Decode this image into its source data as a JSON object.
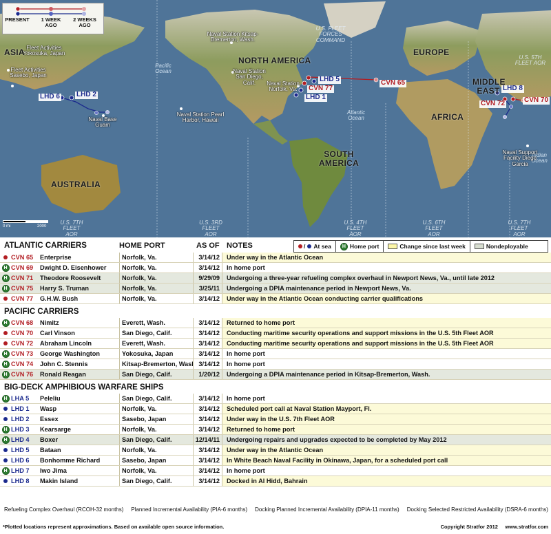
{
  "map": {
    "legend": {
      "labels": [
        "PRESENT",
        "1 WEEK AGO",
        "2 WEEKS AGO"
      ]
    },
    "continents": [
      "NORTH AMERICA",
      "SOUTH AMERICA",
      "EUROPE",
      "ASIA",
      "AFRICA",
      "AUSTRALIA",
      "MIDDLE EAST"
    ],
    "oceans": [
      "Pacific Ocean",
      "Atlantic Ocean",
      "Indian Ocean"
    ],
    "fleet_labels": [
      "U.S. FLEET FORCES COMMAND",
      "U.S. 5TH FLEET AOR",
      "U.S. 7TH FLEET AOR",
      "U.S. 3RD FLEET AOR",
      "U.S. 4TH FLEET AOR",
      "U.S. 6TH FLEET AOR",
      "U.S. 7TH FLEET AOR"
    ],
    "bases": [
      "Fleet Activities Yokosuka, Japan",
      "Fleet Activities Sasebo, Japan",
      "Naval Base Guam",
      "Naval Station Pearl Harbor, Hawaii",
      "Naval Station Kitsap-Bremerton, Wash.",
      "Naval Station San Diego, Calif.",
      "Naval Station Norfolk, Va.",
      "Naval Support Facility Diego Garcia"
    ],
    "ship_labels": {
      "lhd6": "LHD 6",
      "lhd2": "LHD 2",
      "lhd5": "LHD 5",
      "cvn77": "CVN 77",
      "lhd1": "LHD 1",
      "cvn65": "CVN 65",
      "lhd8": "LHD 8",
      "cvn72": "CVN 72",
      "cvn70": "CVN 70"
    },
    "scale": {
      "left": "0 mi",
      "right": "2000"
    },
    "colors": {
      "red": "#b21d22",
      "blue": "#1b2a8d",
      "home": "#2f7d32",
      "ocean": "#4d7296",
      "land": "#8a9a5b"
    }
  },
  "key": {
    "at_sea": "At sea",
    "home_port": "Home port",
    "change": "Change since last week",
    "nondeployable": "Nondeployable"
  },
  "columns": {
    "home_port": "HOME PORT",
    "as_of": "AS OF",
    "notes": "NOTES"
  },
  "sections": [
    {
      "title": "ATLANTIC CARRIERS",
      "rows": [
        {
          "status": "sea",
          "color": "red",
          "hull": "CVN 65",
          "name": "Enterprise",
          "port": "Norfolk, Va.",
          "asof": "3/14/12",
          "notes": "Under way in the Atlantic Ocean"
        },
        {
          "status": "home",
          "color": "red",
          "hull": "CVN 69",
          "name": "Dwight D. Eisenhower",
          "port": "Norfolk, Va.",
          "asof": "3/14/12",
          "notes": "In home port"
        },
        {
          "status": "nd",
          "color": "red",
          "hull": "CVN 71",
          "name": "Theodore Roosevelt",
          "port": "Norfolk, Va.",
          "asof": "9/29/09",
          "notes": "Undergoing a three-year refueling complex overhaul in Newport News, Va., until late 2012"
        },
        {
          "status": "nd",
          "color": "red",
          "hull": "CVN 75",
          "name": "Harry S. Truman",
          "port": "Norfolk, Va.",
          "asof": "3/25/11",
          "notes": "Undergoing a DPIA maintenance period in Newport News, Va."
        },
        {
          "status": "sea",
          "color": "red",
          "hull": "CVN 77",
          "name": "G.H.W. Bush",
          "port": "Norfolk, Va.",
          "asof": "3/14/12",
          "notes": "Under way in the Atlantic Ocean conducting carrier qualifications"
        }
      ]
    },
    {
      "title": "PACIFIC CARRIERS",
      "rows": [
        {
          "status": "change",
          "color": "red",
          "hull": "CVN 68",
          "name": "Nimitz",
          "port": "Everett, Wash.",
          "asof": "3/14/12",
          "notes": "Returned to home port"
        },
        {
          "status": "sea",
          "color": "red",
          "hull": "CVN 70",
          "name": "Carl Vinson",
          "port": "San Diego, Calif.",
          "asof": "3/14/12",
          "notes": "Conducting maritime security operations and support missions in the U.S. 5th Fleet AOR"
        },
        {
          "status": "sea",
          "color": "red",
          "hull": "CVN 72",
          "name": "Abraham Lincoln",
          "port": "Everett, Wash.",
          "asof": "3/14/12",
          "notes": "Conducting maritime security operations and support missions in the U.S. 5th Fleet AOR"
        },
        {
          "status": "home",
          "color": "red",
          "hull": "CVN 73",
          "name": "George Washington",
          "port": "Yokosuka, Japan",
          "asof": "3/14/12",
          "notes": "In home port"
        },
        {
          "status": "home",
          "color": "red",
          "hull": "CVN 74",
          "name": "John C. Stennis",
          "port": "Kitsap-Bremerton, Wash.",
          "asof": "3/14/12",
          "notes": "In home port"
        },
        {
          "status": "nd",
          "color": "red",
          "hull": "CVN 76",
          "name": "Ronald Reagan",
          "port": "San Diego, Calif.",
          "asof": "1/20/12",
          "notes": "Undergoing a DPIA maintenance period in Kitsap-Bremerton, Wash."
        }
      ]
    },
    {
      "title": "BIG-DECK AMPHIBIOUS WARFARE SHIPS",
      "rows": [
        {
          "status": "home",
          "color": "blue",
          "hull": "LHA 5",
          "name": "Peleliu",
          "port": "San Diego, Calif.",
          "asof": "3/14/12",
          "notes": "In home port"
        },
        {
          "status": "sea",
          "color": "blue",
          "hull": "LHD 1",
          "name": "Wasp",
          "port": "Norfolk, Va.",
          "asof": "3/14/12",
          "notes": "Scheduled port call at Naval Station Mayport, Fl."
        },
        {
          "status": "sea",
          "color": "blue",
          "hull": "LHD 2",
          "name": "Essex",
          "port": "Sasebo, Japan",
          "asof": "3/14/12",
          "notes": "Under way in the U.S. 7th Fleet AOR"
        },
        {
          "status": "change",
          "color": "blue",
          "hull": "LHD 3",
          "name": "Kearsarge",
          "port": "Norfolk, Va.",
          "asof": "3/14/12",
          "notes": "Returned to home port"
        },
        {
          "status": "nd",
          "color": "blue",
          "hull": "LHD 4",
          "name": "Boxer",
          "port": "San Diego, Calif.",
          "asof": "12/14/11",
          "notes": "Undergoing repairs and upgrades expected to be completed by May 2012"
        },
        {
          "status": "sea",
          "color": "blue",
          "hull": "LHD 5",
          "name": "Bataan",
          "port": "Norfolk, Va.",
          "asof": "3/14/12",
          "notes": "Under way in the Atlantic Ocean"
        },
        {
          "status": "sea",
          "color": "blue",
          "hull": "LHD 6",
          "name": "Bonhomme Richard",
          "port": "Sasebo, Japan",
          "asof": "3/14/12",
          "notes": "In White Beach Naval Facility in Okinawa, Japan, for a scheduled port call"
        },
        {
          "status": "home",
          "color": "blue",
          "hull": "LHD 7",
          "name": "Iwo Jima",
          "port": "Norfolk, Va.",
          "asof": "3/14/12",
          "notes": "In home port"
        },
        {
          "status": "sea",
          "color": "blue",
          "hull": "LHD 8",
          "name": "Makin Island",
          "port": "San Diego, Calif.",
          "asof": "3/14/12",
          "notes": "Docked in Al Hidd, Bahrain"
        }
      ]
    }
  ],
  "footnotes": [
    "Refueling Complex Overhaul (RCOH-32 months)",
    "Planned Incremental Availability (PIA-6 months)",
    "Docking Planned Incremental Availability (DPIA-11 months)",
    "Docking Selected Restricted Availability (DSRA-6 months)"
  ],
  "disclaimer": "*Plotted locations represent approximations. Based on available open source information.",
  "copyright": "Copyright Stratfor 2012",
  "website": "www.stratfor.com"
}
